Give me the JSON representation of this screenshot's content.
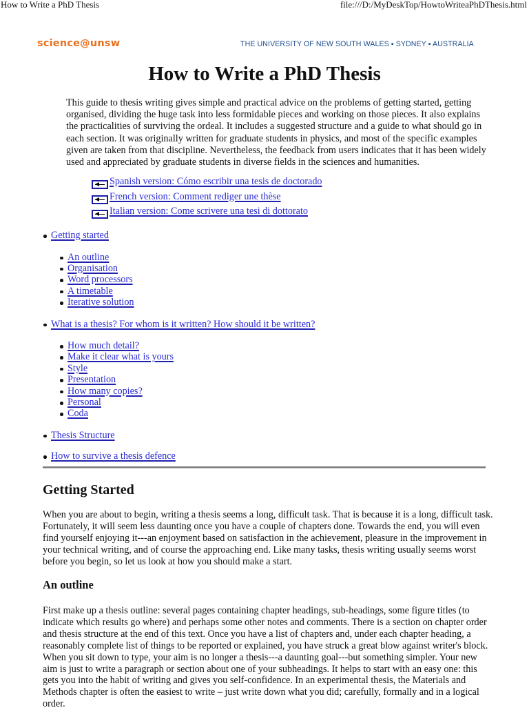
{
  "print_header": {
    "title": "How to Write a PhD Thesis",
    "url": "file:///D:/MyDeskTop/HowtoWriteaPhDThesis.html"
  },
  "banner": {
    "logo": "science@unsw",
    "university": "THE UNIVERSITY OF NEW SOUTH WALES ▪ SYDNEY ▪ AUSTRALIA",
    "logo_color": "#e8701f",
    "university_color": "#1f4e8c"
  },
  "title": "How to Write a PhD Thesis",
  "intro": "This guide to thesis writing gives simple and practical advice on the problems of getting started, getting organised, dividing the huge task into less formidable pieces and working on those pieces. It also explains the practicalities of surviving the ordeal. It includes a suggested structure and a guide to what should go in each section. It was originally written for graduate students in physics, and most of the specific examples given are taken from that discipline. Nevertheless, the feedback from users indicates that it has been widely used and appreciated by graduate students in diverse fields in the sciences and humanities.",
  "translations": [
    {
      "label": "Spanish version: Cómo escribir una tesis de doctorado",
      "icon": "translation-link-icon"
    },
    {
      "label": "French version: Comment rediger une thèse",
      "icon": "translation-link-icon"
    },
    {
      "label": "Italian version: Come scrivere una tesi di dottorato",
      "icon": "translation-link-icon"
    }
  ],
  "toc": [
    {
      "label": "Getting started",
      "children": [
        "An outline",
        "Organisation",
        "Word processors",
        "A timetable",
        "Iterative solution"
      ]
    },
    {
      "label": "What is a thesis? For whom is it written? How should it be written?",
      "children": [
        "How much detail?",
        "Make it clear what is yours",
        "Style",
        "Presentation",
        "How many copies?",
        "Personal",
        "Coda"
      ]
    },
    {
      "label": "Thesis Structure",
      "children": []
    },
    {
      "label": "How to survive a thesis defence",
      "children": []
    }
  ],
  "section": {
    "title": "Getting Started",
    "text": "When you are about to begin, writing a thesis seems a long, difficult task. That is because it is a long, difficult task. Fortunately, it will seem less daunting once you have a couple of chapters done. Towards the end, you will even find yourself enjoying it---an enjoyment based on satisfaction in the achievement, pleasure in the improvement in your technical writing, and of course the approaching end. Like many tasks, thesis writing usually seems worst before you begin, so let us look at how you should make a start."
  },
  "subsection": {
    "title": "An outline",
    "text": "First make up a thesis outline: several pages containing chapter headings, sub-headings, some figure titles (to indicate which results go where) and perhaps some other notes and comments. There is a section on chapter order and thesis structure at the end of this text. Once you have a list of chapters and, under each chapter heading, a reasonably complete list of things to be reported or explained, you have struck a great blow against writer's block. When you sit down to type, your aim is no longer a thesis---a daunting goal---but something simpler. Your new aim is just to write a paragraph or section about one of your subheadings. It helps to start with an easy one: this gets you into the habit of writing and gives you self-confidence. In an experimental thesis, the Materials and Methods chapter is often the easiest to write – just write down what you did; carefully, formally and in a logical order."
  },
  "colors": {
    "link": "#2a2ad6",
    "text": "#111111"
  }
}
